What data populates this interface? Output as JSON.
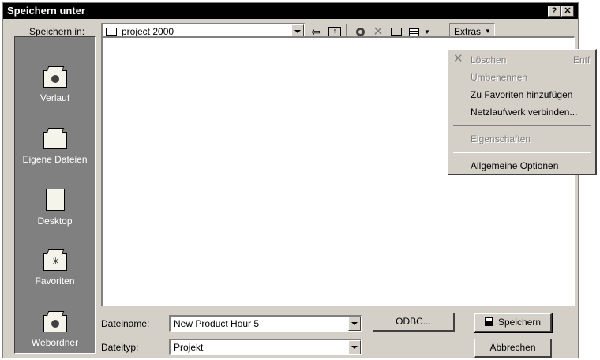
{
  "window": {
    "title": "Speichern unter",
    "help_btn": "?",
    "close_btn": "✕"
  },
  "location": {
    "label": "Speichern in:",
    "value": "project 2000"
  },
  "toolbar": {
    "extras_label": "Extras"
  },
  "places": [
    {
      "label": "Verlauf",
      "icon": "history-folder-icon"
    },
    {
      "label": "Eigene Dateien",
      "icon": "my-documents-folder-icon"
    },
    {
      "label": "Desktop",
      "icon": "desktop-icon"
    },
    {
      "label": "Favoriten",
      "icon": "favorites-folder-icon"
    },
    {
      "label": "Webordner",
      "icon": "web-folders-icon"
    }
  ],
  "filename": {
    "label": "Dateiname:",
    "value": "New Product Hour 5"
  },
  "filetype": {
    "label": "Dateityp:",
    "value": "Projekt"
  },
  "buttons": {
    "odbc": "ODBC...",
    "save": "Speichern",
    "cancel": "Abbrechen"
  },
  "menu": {
    "items": [
      {
        "label": "Löschen",
        "shortcut": "Entf",
        "disabled": true
      },
      {
        "label": "Umbenennen",
        "disabled": true
      },
      {
        "label": "Zu Favoriten hinzufügen",
        "disabled": false
      },
      {
        "label": "Netzlaufwerk verbinden...",
        "disabled": false
      },
      {
        "label": "Eigenschaften",
        "disabled": true
      },
      {
        "label": "Allgemeine Optionen",
        "disabled": false
      }
    ]
  }
}
